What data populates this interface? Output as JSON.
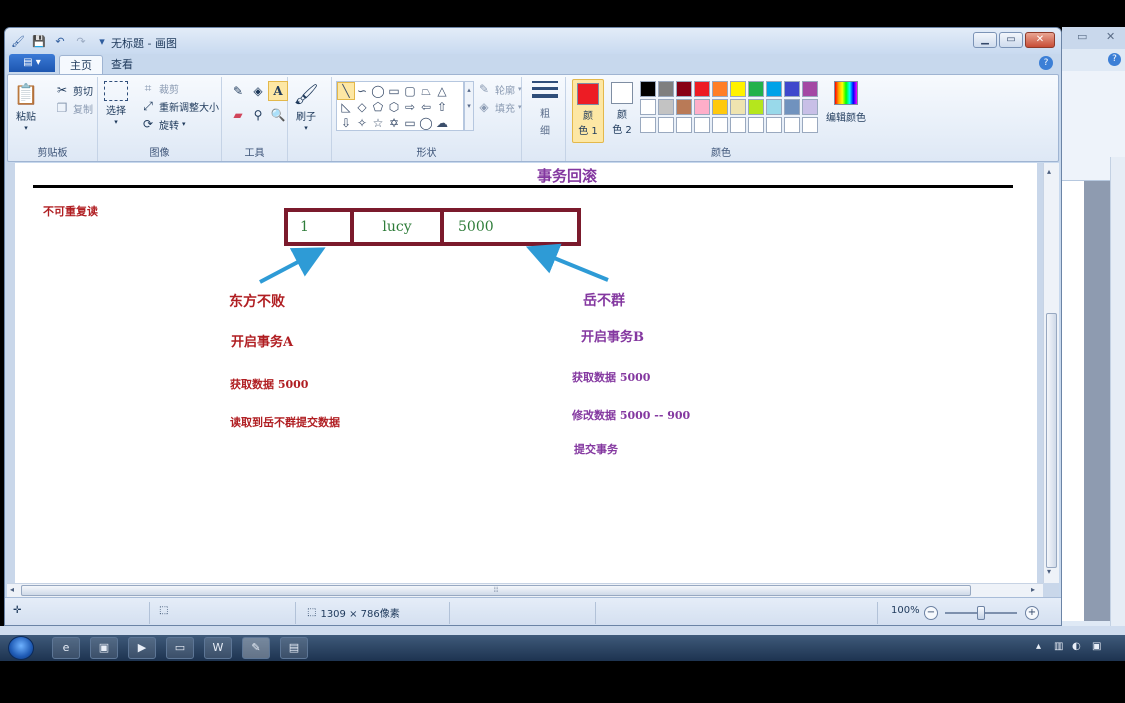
{
  "window": {
    "title": "无标题 - 画图",
    "qat_icons": [
      "save-icon",
      "undo-icon",
      "redo-icon",
      "customize-icon"
    ]
  },
  "tabs": {
    "app_menu": "▤ ▾",
    "home": "主页",
    "view": "查看"
  },
  "ribbon": {
    "clipboard": {
      "label": "剪贴板",
      "paste": "粘贴",
      "cut": "剪切",
      "copy": "复制"
    },
    "image": {
      "label": "图像",
      "select": "选择",
      "crop": "裁剪",
      "resize": "重新调整大小",
      "rotate": "旋转"
    },
    "tools": {
      "label": "工具"
    },
    "brushes": {
      "label": "刷子"
    },
    "shapes": {
      "label": "形状",
      "outline": "轮廓",
      "fill": "填充"
    },
    "size": {
      "label_line1": "粗",
      "label_line2": "细"
    },
    "colors": {
      "label": "颜色",
      "color1_line1": "颜",
      "color1_line2": "色 1",
      "color2_line1": "颜",
      "color2_line2": "色 2",
      "color1_value": "#ed1c24",
      "color2_value": "#ffffff",
      "edit_colors": "编辑颜色",
      "palette": [
        "#000000",
        "#7f7f7f",
        "#880015",
        "#ed1c24",
        "#ff7f27",
        "#fff200",
        "#22b14c",
        "#00a2e8",
        "#3f48cc",
        "#a349a4",
        "#ffffff",
        "#c3c3c3",
        "#b97a57",
        "#ffaec9",
        "#ffc90e",
        "#efe4b0",
        "#b5e61d",
        "#99d9ea",
        "#7092be",
        "#c8bfe7",
        "#ffffff",
        "#ffffff",
        "#ffffff",
        "#ffffff",
        "#ffffff",
        "#ffffff",
        "#ffffff",
        "#ffffff",
        "#ffffff",
        "#ffffff"
      ]
    }
  },
  "drawing": {
    "title": "事务回滚",
    "tag": "不可重复读",
    "record": [
      "1",
      "lucy",
      "5000"
    ],
    "user_a": {
      "name": "东方不败",
      "step1": "开启事务A",
      "step2": "获取数据 5000",
      "step3": "读取到岳不群提交数据"
    },
    "user_b": {
      "name": "岳不群",
      "step1": "开启事务B",
      "step2": "获取数据 5000",
      "step3": "修改数据 5000 -- 900",
      "step4": "提交事务"
    },
    "arrow_color": "#2e9bd6"
  },
  "statusbar": {
    "canvas_size": "1309 × 786像素",
    "zoom": "100%"
  },
  "taskbar": {
    "apps": [
      "ie-icon",
      "app-icon",
      "media-icon",
      "folder-icon",
      "word-icon",
      "paint-icon",
      "window-icon"
    ]
  }
}
